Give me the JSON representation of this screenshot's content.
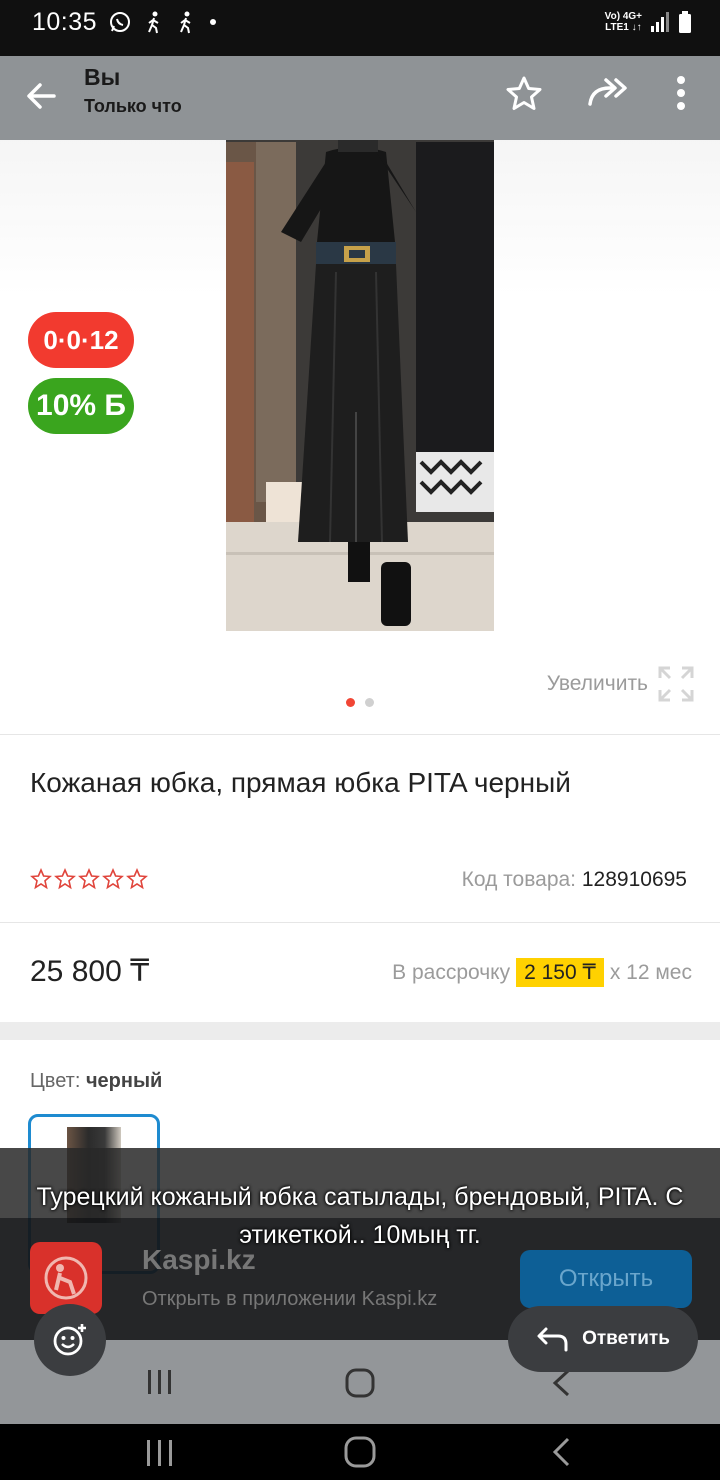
{
  "status_bar": {
    "time": "10:35",
    "network_top": "Vo) 4G+",
    "network_bottom": "LTE1 ↓↑"
  },
  "app_bar": {
    "title": "Вы",
    "subtitle": "Только что"
  },
  "product": {
    "badge_installment": "0·0·12",
    "badge_bonus": "10% Б",
    "zoom_label": "Увеличить",
    "title": "Кожаная юбка, прямая юбка PITA черный",
    "code_label": "Код товара:",
    "code_value": "128910695",
    "price": "25 800 ₸",
    "installment_label": "В рассрочку",
    "installment_amount": "2 150 ₸",
    "installment_term": "x 12 мес",
    "color_label": "Цвет:",
    "color_value": "черный"
  },
  "caption": "Турецкий кожаный юбка сатылады, брендовый, PITA. С этикеткой.. 10мың тг.",
  "kaspi_banner": {
    "name": "Kaspi.kz",
    "subtitle": "Открыть в приложении Kaspi.kz",
    "open_label": "Открыть"
  },
  "reply_label": "Ответить",
  "colors": {
    "accent_red": "#f23a2f",
    "bonus_green": "#3aa51e",
    "highlight_yellow": "#ffd100",
    "selected_blue": "#1e8bd0"
  }
}
